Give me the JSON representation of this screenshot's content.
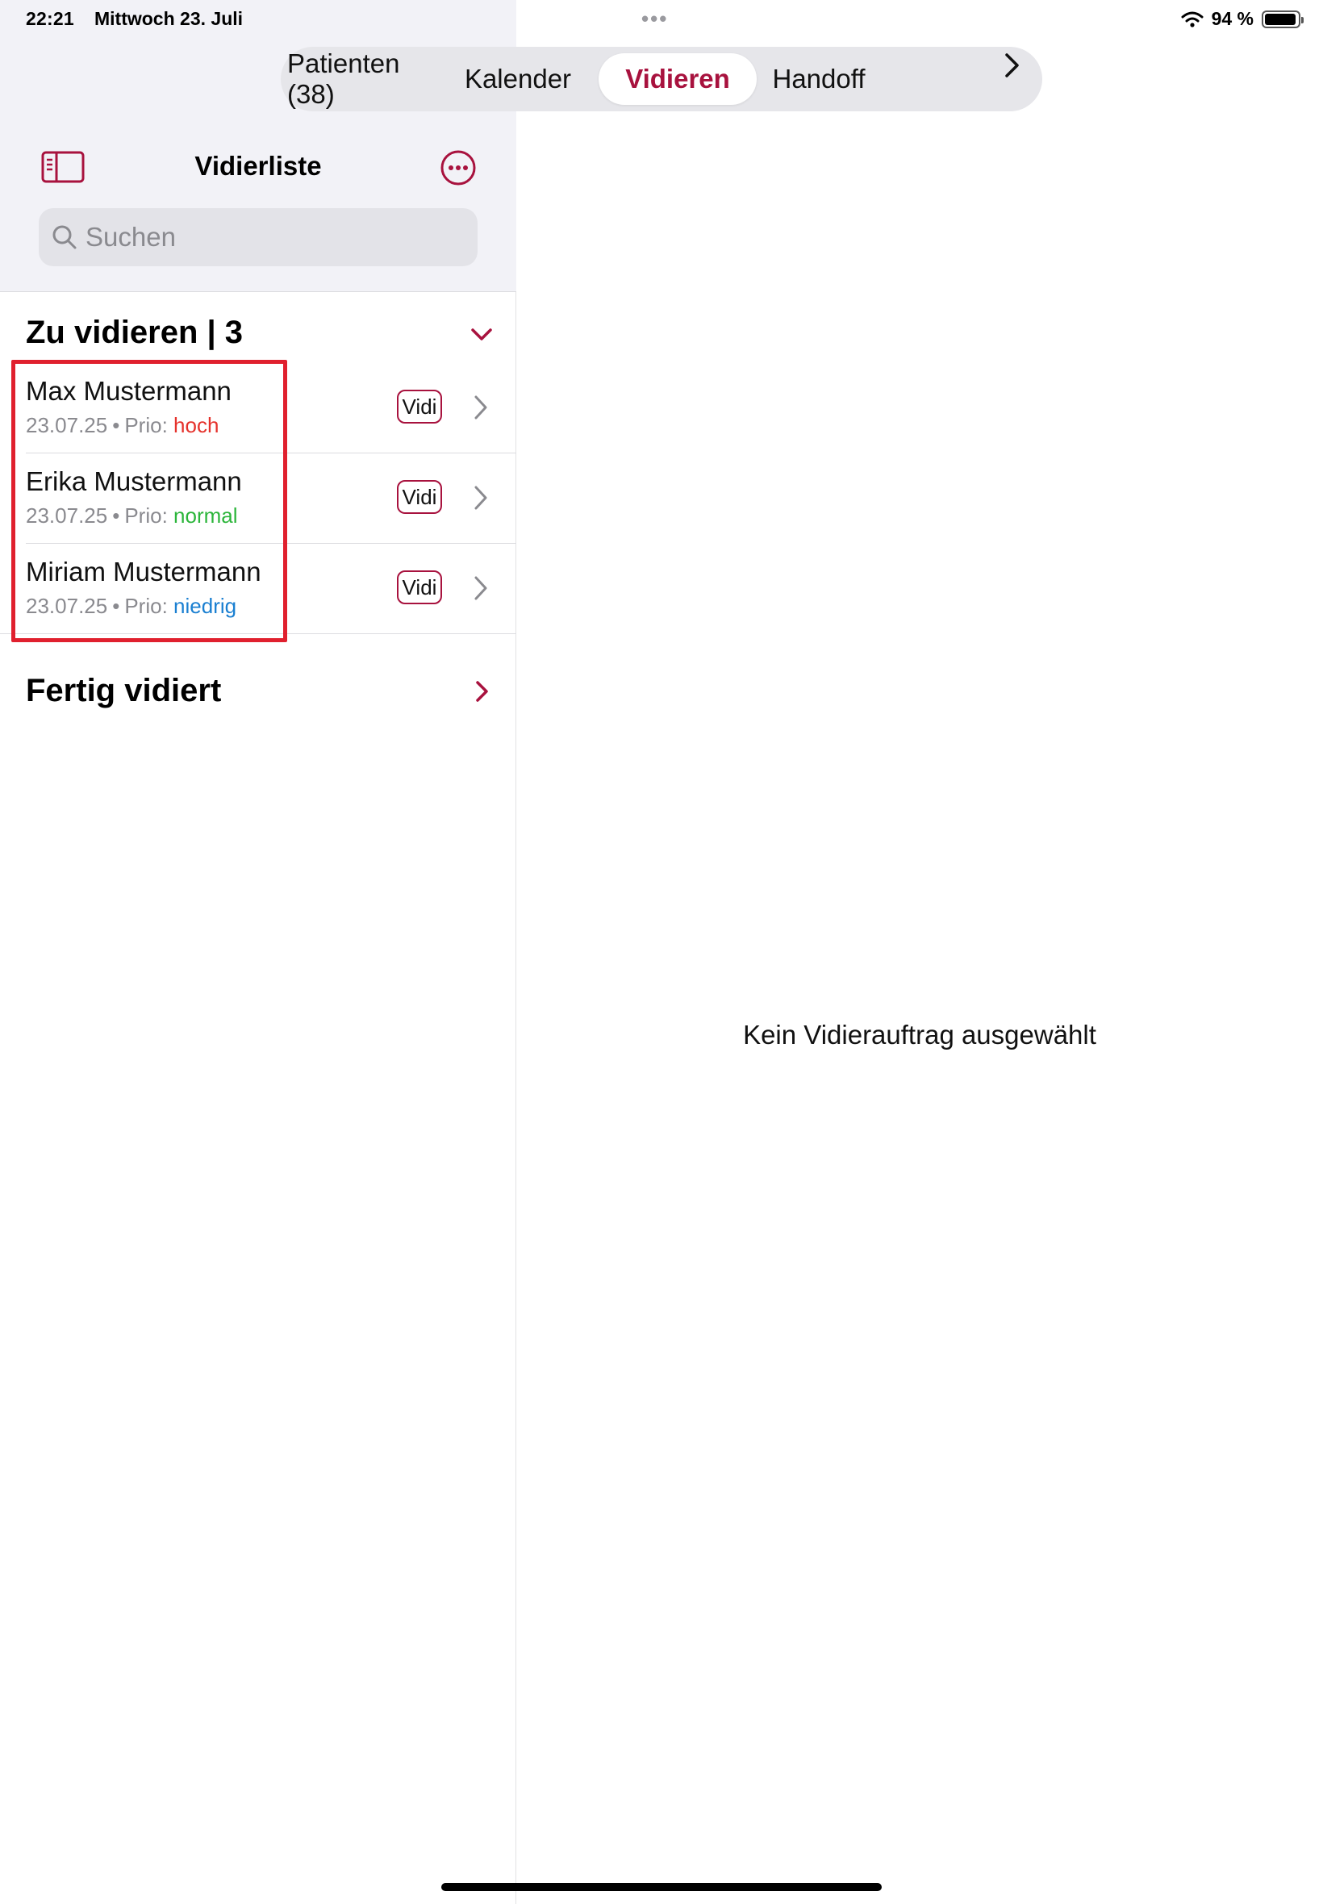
{
  "status_bar": {
    "time": "22:21",
    "date": "Mittwoch 23. Juli",
    "battery": "94 %",
    "battery_level": 0.94
  },
  "tabs": [
    {
      "label": "Patienten (38)",
      "active": false
    },
    {
      "label": "Kalender",
      "active": false
    },
    {
      "label": "Vidieren",
      "active": true
    },
    {
      "label": "Handoff",
      "active": false
    }
  ],
  "sidebar": {
    "title": "Vidierliste",
    "search_placeholder": "Suchen",
    "section_pending": "Zu vidieren | 3",
    "section_done": "Fertig vidiert",
    "items": [
      {
        "name": "Max Mustermann",
        "date": "23.07.25",
        "prio_label": "Prio:",
        "prio": "hoch",
        "prio_color": "#e5312b",
        "badge": "Vidi"
      },
      {
        "name": "Erika Mustermann",
        "date": "23.07.25",
        "prio_label": "Prio:",
        "prio": "normal",
        "prio_color": "#2bb53a",
        "badge": "Vidi"
      },
      {
        "name": "Miriam Mustermann",
        "date": "23.07.25",
        "prio_label": "Prio:",
        "prio": "niedrig",
        "prio_color": "#1a7fd1",
        "badge": "Vidi"
      }
    ]
  },
  "detail": {
    "empty_message": "Kein Vidierauftrag ausgewählt"
  },
  "colors": {
    "accent": "#a8123e",
    "highlight": "#e0202e"
  }
}
